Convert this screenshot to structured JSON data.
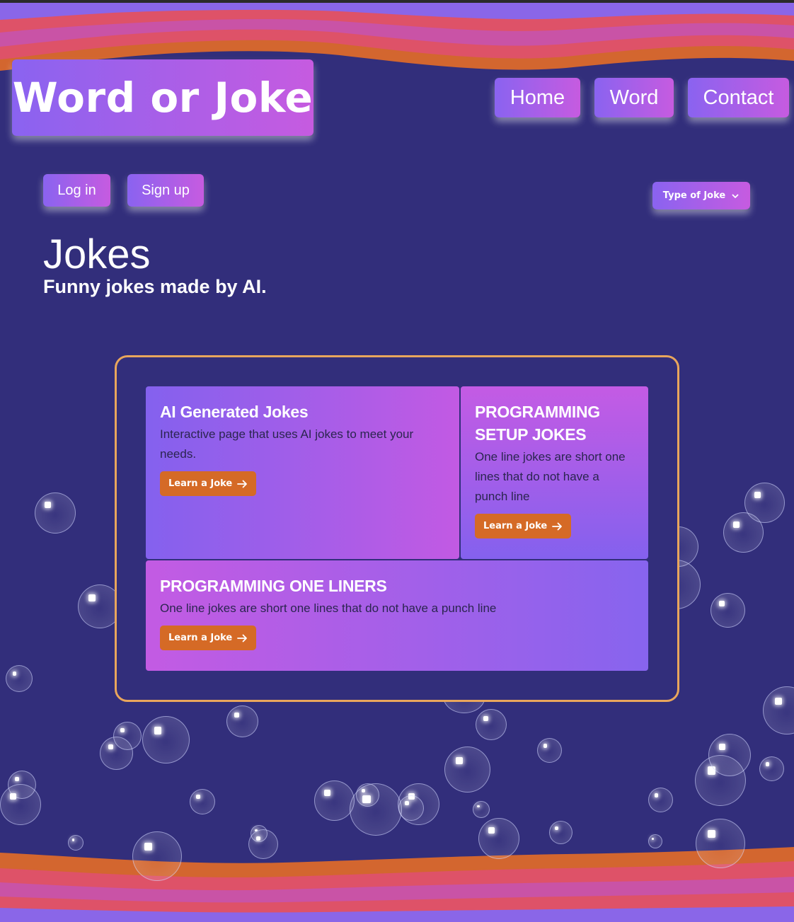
{
  "header": {
    "logo": "Word or Joke",
    "nav": [
      "Home",
      "Word",
      "Contact"
    ]
  },
  "auth": {
    "login": "Log in",
    "signup": "Sign up"
  },
  "dropdown": {
    "label": "Type of Joke"
  },
  "hero": {
    "title": "Jokes",
    "subtitle": "Funny jokes made by AI."
  },
  "cards": [
    {
      "title": "AI Generated Jokes",
      "text": "Interactive page that uses AI jokes to meet your needs.",
      "button": "Learn a Joke"
    },
    {
      "title": "PROGRAMMING SETUP JOKES",
      "text": "One line jokes are short one lines that do not have a punch line",
      "button": "Learn a Joke"
    },
    {
      "title": "PROGRAMMING ONE LINERS",
      "text": "One line jokes are short one lines that do not have a punch line",
      "button": "Learn a Joke"
    }
  ],
  "icons": {
    "dropdown": "chevron-down-icon",
    "button_arrow": "arrow-right-icon"
  },
  "colors": {
    "background": "#322e7b",
    "gradient_start": "#8a63f0",
    "gradient_end": "#c65be0",
    "frame_border": "#e9a65c",
    "cta_button": "#d56a26"
  }
}
